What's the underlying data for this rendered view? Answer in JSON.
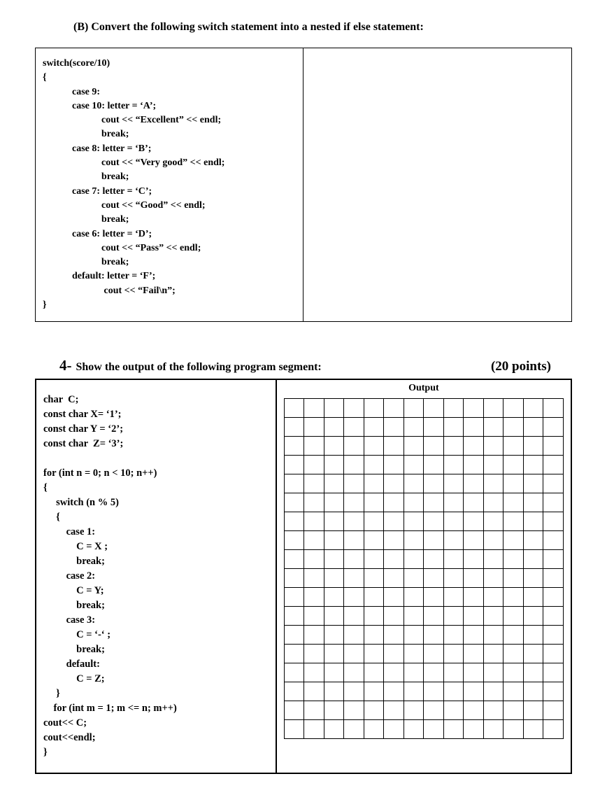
{
  "partB": {
    "heading": "(B)  Convert the following switch statement into a nested if else statement:",
    "code": "switch(score/10)\n{\n            case 9:\n            case 10: letter = ‘A’;\n                        cout << “Excellent” << endl;\n                        break;\n            case 8: letter = ‘B’;\n                        cout << “Very good” << endl;\n                        break;\n            case 7: letter = ‘C’;\n                        cout << “Good” << endl;\n                        break;\n            case 6: letter = ‘D’;\n                        cout << “Pass” << endl;\n                        break;\n            default: letter = ‘F’;\n                         cout << “Fail\\n”;\n}"
  },
  "q4": {
    "num": "4-",
    "text": " Show the output of the following program segment:",
    "points": "(20  points)",
    "outputLabel": "Output",
    "grid": {
      "rows": 18,
      "cols": 14
    },
    "code": "char  C;\nconst char X= ‘1’;\nconst char Y = ‘2’;\nconst char  Z= ‘3’;\n\nfor (int n = 0; n < 10; n++)\n{\n     switch (n % 5)\n     {\n         case 1:\n             C = X ;\n             break;\n         case 2:\n             C = Y;\n             break;\n         case 3:\n             C = ‘-‘ ;\n             break;\n         default:\n             C = Z;\n     }\n    for (int m = 1; m <= n; m++)\ncout<< C;\ncout<<endl;\n}"
  }
}
